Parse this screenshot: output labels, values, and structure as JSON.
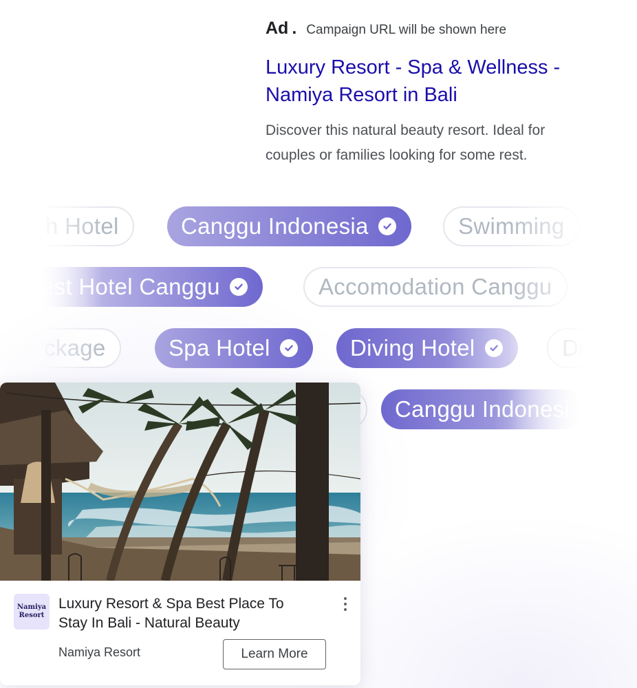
{
  "text_ad": {
    "ad_label": "Ad",
    "separator": ".",
    "url_placeholder": "Campaign URL will be shown here",
    "headline_line1": "Luxury Resort - Spa & Wellness -",
    "headline_line2": "Namiya Resort in Bali",
    "description_line1": "Discover this natural beauty resort. Ideal for",
    "description_line2": "couples or families looking for some rest.",
    "title_color": "#1a0dab"
  },
  "keyword_chips": [
    {
      "label": "h Hotel",
      "selected": false
    },
    {
      "label": "Canggu Indonesia",
      "selected": true
    },
    {
      "label": "Swimming",
      "selected": false
    },
    {
      "label": "est Hotel Canggu",
      "selected": true
    },
    {
      "label": "Accomodation Canggu",
      "selected": false
    },
    {
      "label": "ckage",
      "selected": false
    },
    {
      "label": "Spa Hotel",
      "selected": true
    },
    {
      "label": "Diving Hotel",
      "selected": true
    },
    {
      "label": "Di",
      "selected": false
    },
    {
      "label": "Canggu Indonesi",
      "selected": true
    }
  ],
  "chip_colors": {
    "selected_start": "#a9a4e0",
    "selected_end": "#6f68cf",
    "unselected_text": "#b0b8c2"
  },
  "display_ad": {
    "image_icon": "beach-resort-photo",
    "logo_line1": "Namiya",
    "logo_line2": "Resort",
    "headline_line1": "Luxury Resort & Spa Best Place To",
    "headline_line2": "Stay In Bali - Natural Beauty",
    "advertiser": "Namiya Resort",
    "cta": "Learn More",
    "menu_icon": "more-vertical-icon"
  }
}
